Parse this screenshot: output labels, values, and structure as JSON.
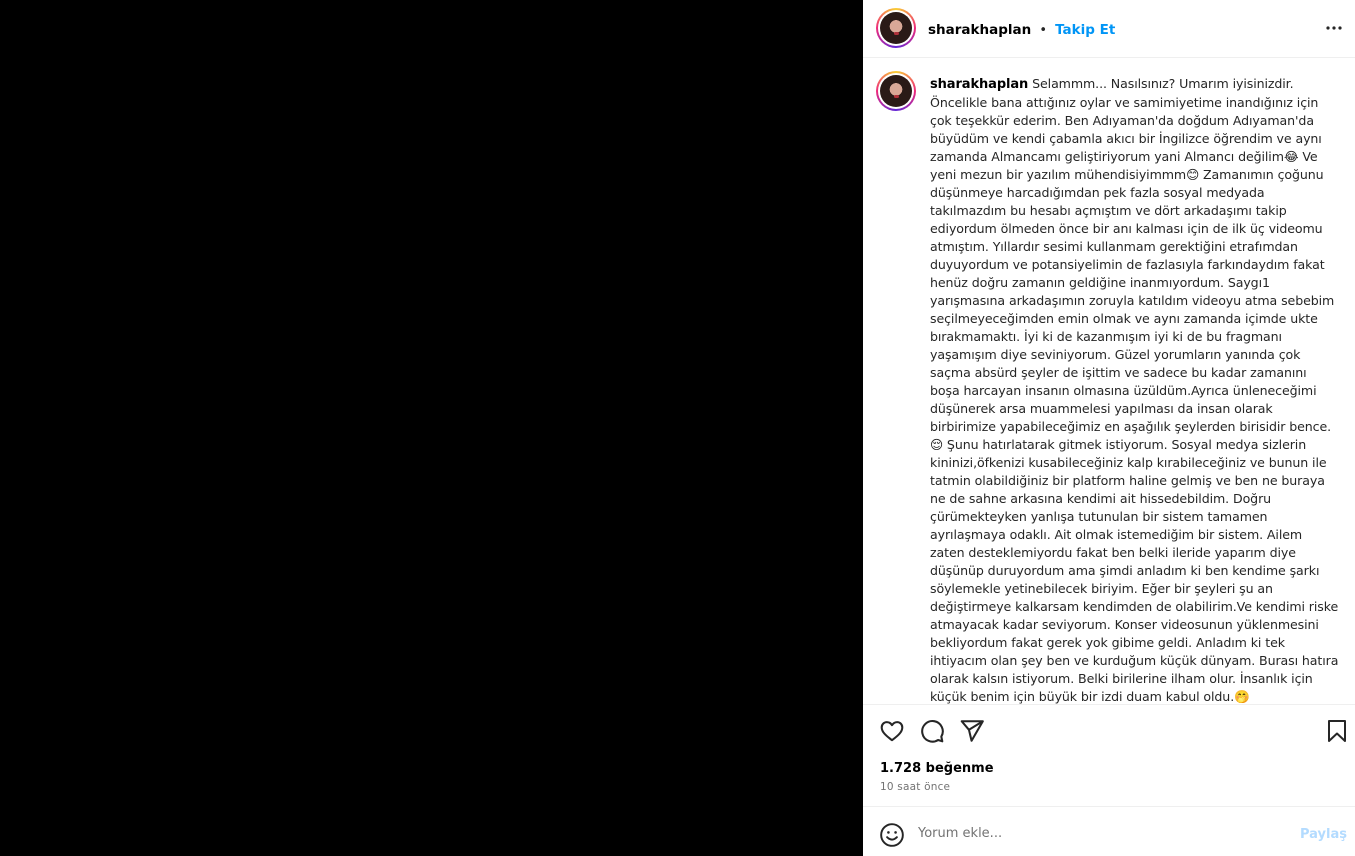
{
  "post": {
    "username": "sharakhaplan",
    "separator": "•",
    "follow_label": "Takip Et",
    "caption_username": "sharakhaplan",
    "caption_text": "Selammm... Nasılsınız? Umarım iyisinizdir. Öncelikle bana attığınız oylar ve samimiyetime inandığınız için çok teşekkür ederim. Ben Adıyaman'da doğdum Adıyaman'da büyüdüm ve kendi çabamla akıcı bir İngilizce öğrendim ve aynı zamanda Almancamı geliştiriyorum yani Almancı değilim😂 Ve yeni mezun bir yazılım mühendisiyimmm😊 Zamanımın çoğunu düşünmeye harcadığımdan pek fazla sosyal medyada takılmazdım bu hesabı açmıştım ve dört arkadaşımı takip ediyordum ölmeden önce bir anı kalması için de ilk üç videomu atmıştım. Yıllardır sesimi kullanmam gerektiğini etrafımdan duyuyordum ve potansiyelimin de fazlasıyla farkındaydım fakat henüz doğru zamanın geldiğine inanmıyordum. Saygı1 yarışmasına arkadaşımın zoruyla katıldım videoyu atma sebebim seçilmeyeceğimden emin olmak ve aynı zamanda içimde ukte bırakmamaktı. İyi ki de kazanmışım iyi ki de bu fragmanı yaşamışım diye seviniyorum. Güzel yorumların yanında çok saçma absürd şeyler de işittim ve sadece bu kadar zamanını boşa harcayan insanın olmasına üzüldüm.Ayrıca ünleneceğimi düşünerek arsa muammelesi yapılması da insan olarak birbirimize yapabileceğimiz en aşağılık şeylerden birisidir bence.😌 Şunu hatırlatarak gitmek istiyorum. Sosyal medya sizlerin kininizi,öfkenizi kusabileceğiniz kalp kırabileceğiniz ve bunun ile tatmin olabildiğiniz bir platform haline gelmiş ve ben ne buraya ne de sahne arkasına kendimi ait hissedebildim. Doğru çürümekteyken yanlışa tutunulan bir sistem tamamen ayrılaşmaya odaklı. Ait olmak istemediğim bir sistem. Ailem zaten desteklemiyordu fakat ben belki ileride yaparım diye düşünüp duruyordum ama şimdi anladım ki ben kendime şarkı söylemekle yetinebilecek biriyim. Eğer bir şeyleri şu an değiştirmeye kalkarsam kendimden de olabilirim.Ve kendimi riske atmayacak kadar seviyorum. Konser videosunun yüklenmesini bekliyordum fakat gerek yok gibime geldi. Anladım ki tek ihtiyacım olan şey ben ve kurduğum küçük dünyam. Burası hatıra olarak kalsın istiyorum. Belki birilerine ilham olur. İnsanlık için küçük benim için büyük bir izdi duam kabul oldu.🤭 Samimiyetinizin ve birbiriniz için iyi dileklerin eksilmediği bir",
    "likes": "1.728 beğenme",
    "time_ago": "10 saat önce",
    "comment_placeholder": "Yorum ekle...",
    "share_label": "Paylaş"
  },
  "icons": {
    "more": "more-options-icon",
    "like": "heart-icon",
    "comment": "comment-icon",
    "share": "send-icon",
    "save": "bookmark-icon",
    "emoji": "emoji-icon"
  },
  "colors": {
    "accent": "#0095f6",
    "share_disabled": "#b3dbff",
    "muted": "#737373"
  }
}
